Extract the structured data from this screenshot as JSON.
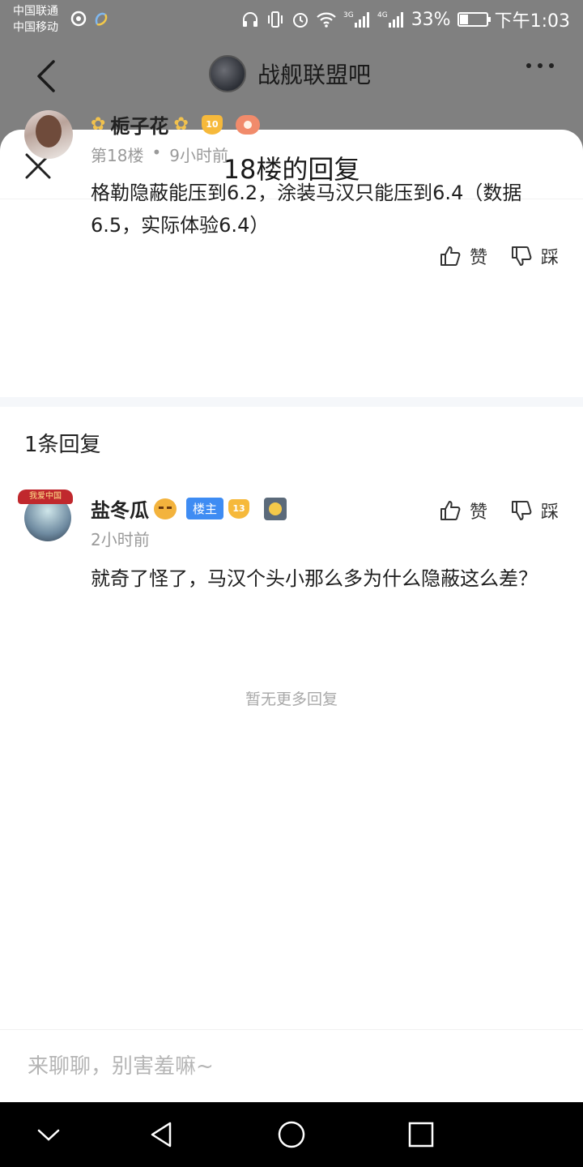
{
  "status_bar": {
    "carrier1": "中国联通",
    "carrier2": "中国移动",
    "battery_pct": "33%",
    "battery_level": 0.33,
    "time": "下午1:03"
  },
  "header": {
    "forum_name": "战舰联盟吧"
  },
  "sheet": {
    "title": "18楼的回复"
  },
  "post": {
    "username": "栀子花",
    "level": "10",
    "floor": "第18楼",
    "time": "9小时前",
    "content": "格勒隐蔽能压到6.2，涂装马汉只能压到6.4（数据6.5，实际体验6.4）",
    "like_label": "赞",
    "dislike_label": "踩"
  },
  "replies_header": "1条回复",
  "reply": {
    "avatar_banner": "我爱中国",
    "username": "盐冬瓜",
    "owner_badge": "楼主",
    "level": "13",
    "time": "2小时前",
    "content": "就奇了怪了，马汉个头小那么多为什么隐蔽这么差？",
    "like_label": "赞",
    "dislike_label": "踩"
  },
  "no_more": "暂无更多回复",
  "input": {
    "placeholder": "来聊聊，别害羞嘛~"
  },
  "colors": {
    "accent_blue": "#3e8cf3",
    "badge_gold": "#f6b93b",
    "dim_overlay": "#808080"
  }
}
